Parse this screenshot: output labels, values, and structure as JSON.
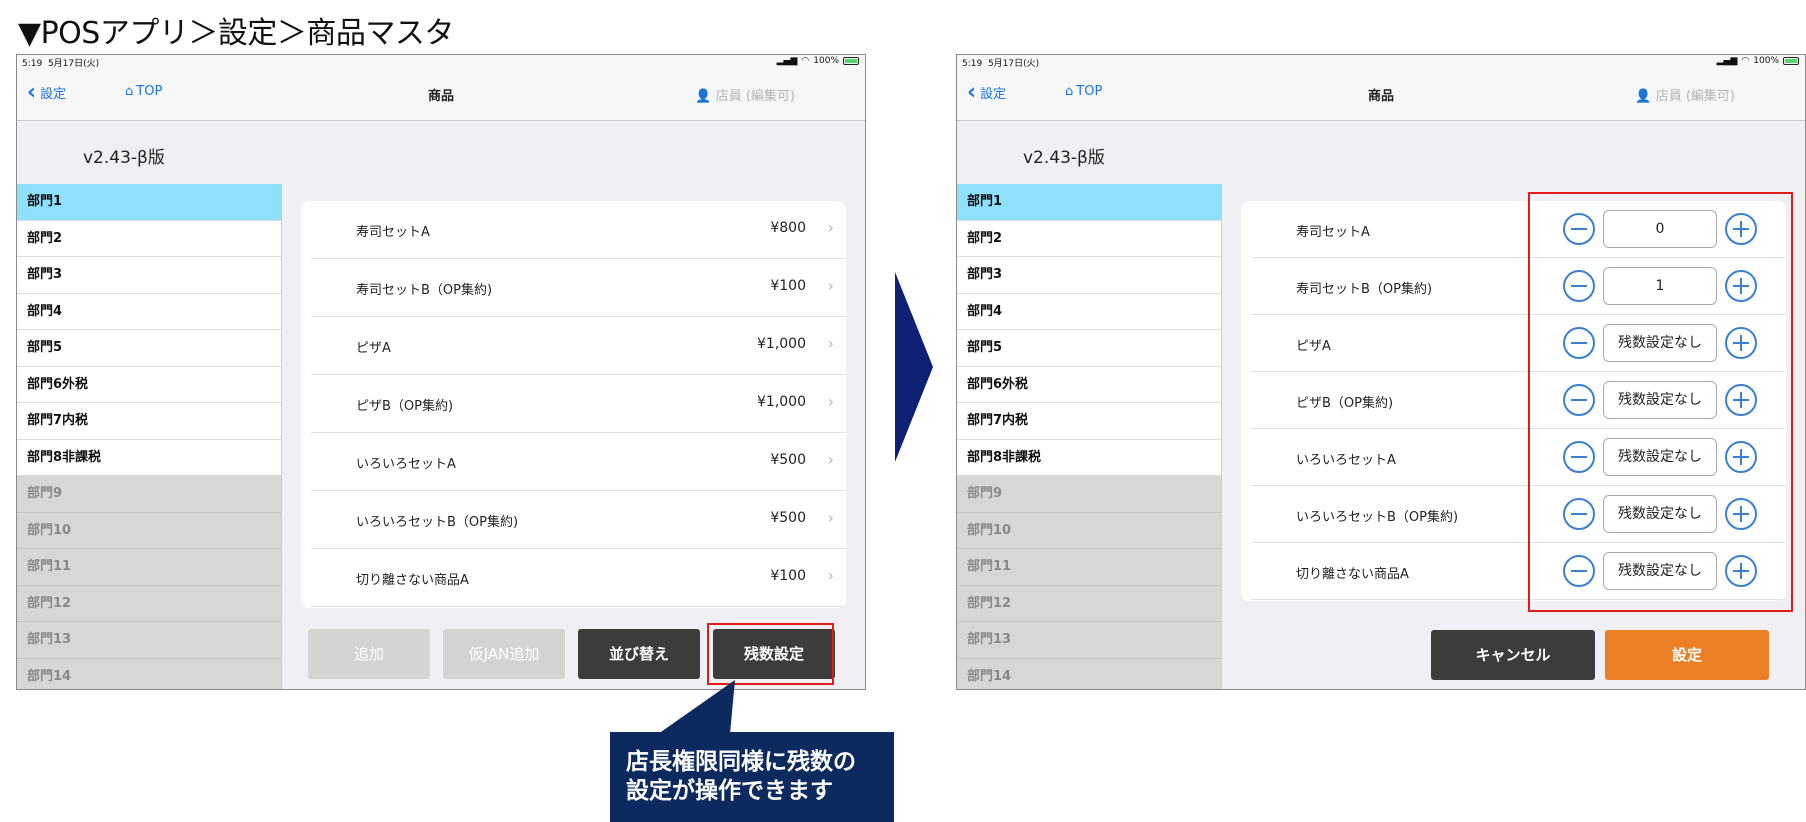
{
  "page_title": "▼POSアプリ＞設定＞商品マスタ",
  "status": {
    "time": "5:19",
    "date": "5月17日(火)",
    "battery": "100%"
  },
  "nav": {
    "back": "設定",
    "top": "TOP",
    "title": "商品",
    "staff": "店員 (編集可)"
  },
  "version": "v2.43-β版",
  "departments": [
    {
      "label": "部門1",
      "state": "active"
    },
    {
      "label": "部門2",
      "state": "enabled"
    },
    {
      "label": "部門3",
      "state": "enabled"
    },
    {
      "label": "部門4",
      "state": "enabled"
    },
    {
      "label": "部門5",
      "state": "enabled"
    },
    {
      "label": "部門6外税",
      "state": "enabled"
    },
    {
      "label": "部門7内税",
      "state": "enabled"
    },
    {
      "label": "部門8非課税",
      "state": "enabled"
    },
    {
      "label": "部門9",
      "state": "disabled"
    },
    {
      "label": "部門10",
      "state": "disabled"
    },
    {
      "label": "部門11",
      "state": "disabled"
    },
    {
      "label": "部門12",
      "state": "disabled"
    },
    {
      "label": "部門13",
      "state": "disabled"
    },
    {
      "label": "部門14",
      "state": "disabled"
    }
  ],
  "products": [
    {
      "name": "寿司セットA",
      "price": "¥800",
      "stock": "0"
    },
    {
      "name": "寿司セットB（OP集約)",
      "price": "¥100",
      "stock": "1"
    },
    {
      "name": "ピザA",
      "price": "¥1,000",
      "stock": "残数設定なし"
    },
    {
      "name": "ピザB（OP集約)",
      "price": "¥1,000",
      "stock": "残数設定なし"
    },
    {
      "name": "いろいろセットA",
      "price": "¥500",
      "stock": "残数設定なし"
    },
    {
      "name": "いろいろセットB（OP集約)",
      "price": "¥500",
      "stock": "残数設定なし"
    },
    {
      "name": "切り離さない商品A",
      "price": "¥100",
      "stock": "残数設定なし"
    }
  ],
  "left_buttons": {
    "add": "追加",
    "jan_add": "仮JAN追加",
    "sort": "並び替え",
    "stock_settings": "残数設定"
  },
  "right_buttons": {
    "cancel": "キャンセル",
    "set": "設定"
  },
  "callout": {
    "line1": "店長権限同様に残数の",
    "line2": "設定が操作できます"
  },
  "colors": {
    "accent_blue": "#1a73e8",
    "active_dept": "#8fe0fb",
    "highlight_red": "#e21a1a",
    "orange": "#ea7f25",
    "navy": "#0d2a5e"
  }
}
